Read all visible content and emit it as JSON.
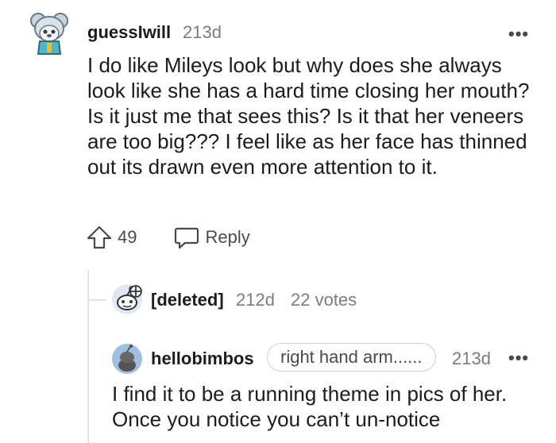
{
  "comment": {
    "username": "guessIwill",
    "age": "213d",
    "more": "•••",
    "body": "I do like Mileys look but why does she always look like she has a hard time closing her mouth? Is it just me that sees this? Is it that her veneers are too big??? I feel like as her face has thinned out its drawn even more attention to it.",
    "votes": "49",
    "reply_label": "Reply"
  },
  "deleted_reply": {
    "username": "[deleted]",
    "age": "212d",
    "votes": "22 votes"
  },
  "nested_reply": {
    "username": "hellobimbos",
    "flair": "right hand arm......",
    "age": "213d",
    "more": "•••",
    "body": "I find it to be a running theme in pics of her. Once you notice you can’t un-notice"
  },
  "colors": {
    "text": "#1c1c1c",
    "meta": "#7c7c7c",
    "icon": "#4a4a4a",
    "thread_line": "#e4e4e4",
    "snoo_blue": "#9fc0e0"
  }
}
